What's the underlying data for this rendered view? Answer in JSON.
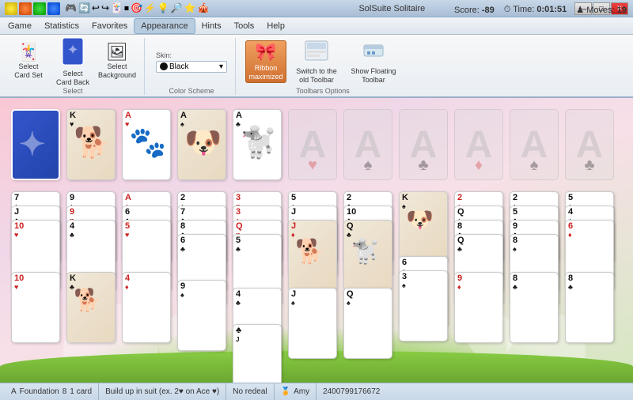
{
  "window": {
    "title": "SolSuite Solitaire",
    "controls": [
      "—",
      "□",
      "✕"
    ]
  },
  "titlebar_icons": [
    "🎮",
    "🎯",
    "🔧",
    "⚡",
    "🃏",
    "🔄",
    "🌟",
    "🎲",
    "💡",
    "🔎",
    "🎪"
  ],
  "menu": {
    "items": [
      "Game",
      "Statistics",
      "Favorites",
      "Appearance",
      "Hints",
      "Tools",
      "Help"
    ]
  },
  "ribbon": {
    "groups": [
      {
        "label": "Select",
        "items": [
          {
            "id": "select-card-set",
            "icon": "🃏",
            "label": "Select\nCard Set"
          },
          {
            "id": "select-card-back",
            "icon": "🔵",
            "label": "Select\nCard Back"
          },
          {
            "id": "select-background",
            "icon": "🖼",
            "label": "Select\nBackground"
          }
        ]
      },
      {
        "label": "Color Scheme",
        "skin_label": "Skin:",
        "skin_value": "Black"
      },
      {
        "label": "Toolbars Options",
        "items": [
          {
            "id": "ribbon-maximized",
            "icon": "🎀",
            "label": "Ribbon\nmaximized",
            "active": true
          },
          {
            "id": "switch-old",
            "icon": "🔧",
            "label": "Switch to the\nold Toolbar"
          },
          {
            "id": "show-floating",
            "icon": "📌",
            "label": "Show Floating\nToolbar"
          }
        ]
      }
    ]
  },
  "hud": {
    "score_label": "Score:",
    "score_value": "-89",
    "time_label": "Time:",
    "time_value": "0:01:51",
    "moves_label": "Moves:",
    "moves_value": "19"
  },
  "foundation": {
    "suits": [
      "♠",
      "♥",
      "♣",
      "♦"
    ]
  },
  "statusbar": {
    "foundation": "Foundation",
    "foundation_count": "8",
    "foundation_detail": "1 card",
    "build_label": "Build up in suit (ex. 2♥ on Ace ♥)",
    "redeal": "No redeal",
    "user": "Amy",
    "code": "2400799176672"
  }
}
